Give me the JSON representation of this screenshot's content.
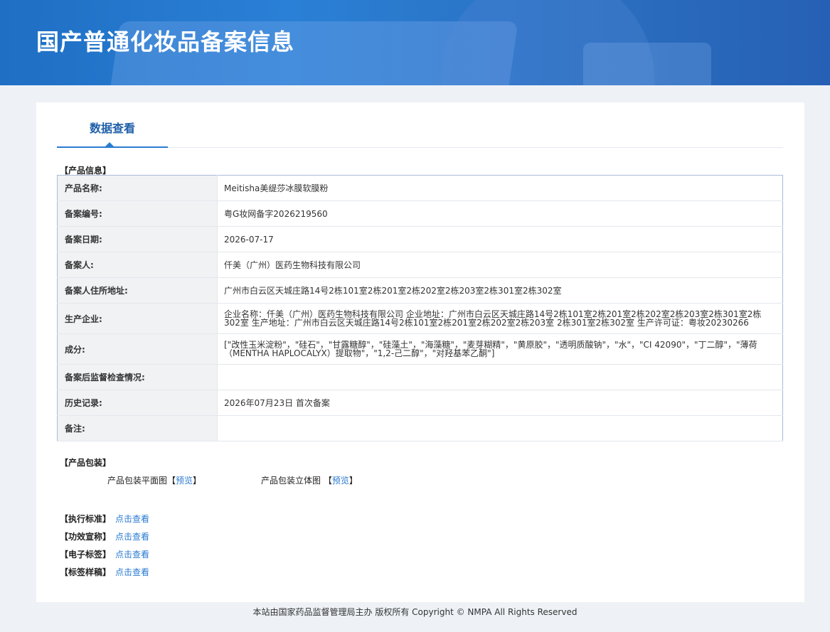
{
  "header": {
    "title": "国产普通化妆品备案信息"
  },
  "tabs": [
    {
      "label": "数据查看"
    }
  ],
  "product_info": {
    "section_label": "【产品信息】",
    "rows": [
      {
        "key": "产品名称:",
        "value": "Meitisha美缇莎冰膜软膜粉"
      },
      {
        "key": "备案编号:",
        "value": "粤G妆网备字2026219560"
      },
      {
        "key": "备案日期:",
        "value": "2026-07-17"
      },
      {
        "key": "备案人:",
        "value": "仟美（广州）医药生物科技有限公司"
      },
      {
        "key": "备案人住所地址:",
        "value": "广州市白云区天城庄路14号2栋101室2栋201室2栋202室2栋203室2栋301室2栋302室"
      },
      {
        "key": "生产企业:",
        "value": "企业名称：仟美（广州）医药生物科技有限公司 企业地址：广州市白云区天城庄路14号2栋101室2栋201室2栋202室2栋203室2栋301室2栋302室 生产地址：广州市白云区天城庄路14号2栋101室2栋201室2栋202室2栋203室 2栋301室2栋302室 生产许可证：粤妆20230266"
      },
      {
        "key": "成分:",
        "value": "[\"改性玉米淀粉\"，\"硅石\"，\"甘露糖醇\"，\"硅藻土\"，\"海藻糖\"，\"麦芽糊精\"，\"黄原胶\"，\"透明质酸钠\"，\"水\"，\"CI 42090\"，\"丁二醇\"，\"薄荷（MENTHA HAPLOCALYX）提取物\"，\"1,2-己二醇\"，\"对羟基苯乙酮\"]"
      },
      {
        "key": "备案后监督检查情况:",
        "value": ""
      },
      {
        "key": "历史记录:",
        "value": "2026年07月23日 首次备案"
      },
      {
        "key": "备注:",
        "value": ""
      }
    ]
  },
  "packaging": {
    "section_label": "【产品包装】",
    "flat_label": "产品包装平面图",
    "solid_label": "产品包装立体图",
    "preview_label": "预览",
    "bracket_open": "【",
    "bracket_close": "】"
  },
  "links": [
    {
      "label": "【执行标准】",
      "link": "点击查看"
    },
    {
      "label": "【功效宣称】",
      "link": "点击查看"
    },
    {
      "label": "【电子标签】",
      "link": "点击查看"
    },
    {
      "label": "【标签样稿】",
      "link": "点击查看"
    }
  ],
  "footer": {
    "text": "本站由国家药品监督管理局主办 版权所有 Copyright © NMPA All Rights Reserved"
  }
}
